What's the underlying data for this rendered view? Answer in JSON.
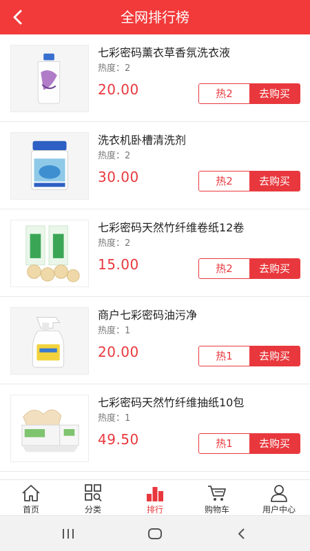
{
  "header": {
    "title": "全网排行榜"
  },
  "products": [
    {
      "name": "七彩密码薰衣草香氛洗衣液",
      "heat": "热度：2",
      "price": "20.00",
      "hot": "热2",
      "buy": "去购买"
    },
    {
      "name": "洗衣机卧槽清洗剂",
      "heat": "热度：2",
      "price": "30.00",
      "hot": "热2",
      "buy": "去购买"
    },
    {
      "name": "七彩密码天然竹纤维卷纸12卷",
      "heat": "热度：2",
      "price": "15.00",
      "hot": "热2",
      "buy": "去购买"
    },
    {
      "name": "商户七彩密码油污净",
      "heat": "热度：1",
      "price": "20.00",
      "hot": "热1",
      "buy": "去购买"
    },
    {
      "name": "七彩密码天然竹纤维抽纸10包",
      "heat": "热度：1",
      "price": "49.50",
      "hot": "热1",
      "buy": "去购买"
    }
  ],
  "tabbar": {
    "items": [
      {
        "label": "首页",
        "icon": "home-icon"
      },
      {
        "label": "分类",
        "icon": "category-icon"
      },
      {
        "label": "排行",
        "icon": "ranking-icon",
        "active": true
      },
      {
        "label": "购物车",
        "icon": "cart-icon"
      },
      {
        "label": "用户中心",
        "icon": "user-icon"
      }
    ]
  },
  "colors": {
    "brand": "#f23a3a",
    "price": "#e8383d"
  }
}
